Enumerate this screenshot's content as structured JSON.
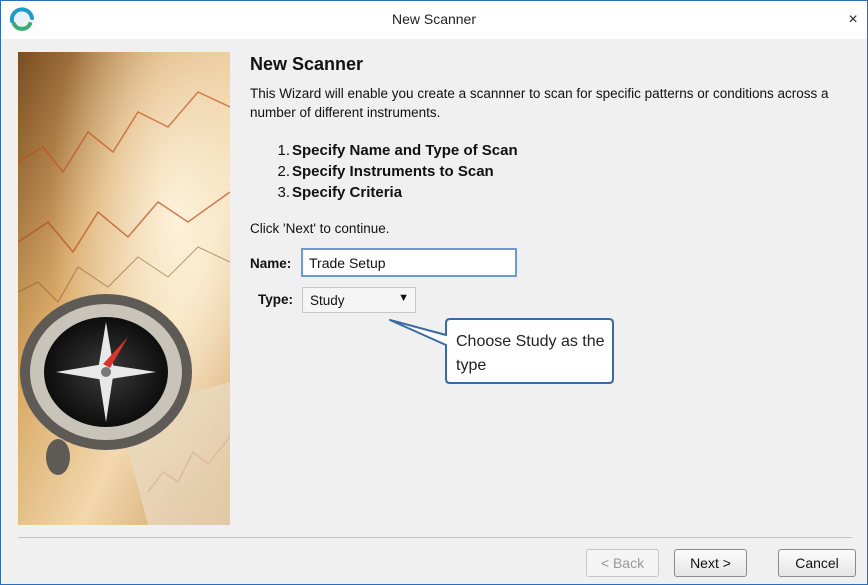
{
  "window": {
    "title": "New Scanner",
    "close_glyph": "×",
    "logo_icon": "app-logo-icon"
  },
  "content": {
    "heading": "New Scanner",
    "description": "This Wizard will enable you create a scannner to scan for specific patterns or conditions across a number of different instruments.",
    "steps": [
      {
        "num": "1.",
        "label": "Specify Name and Type of Scan"
      },
      {
        "num": "2.",
        "label": "Specify Instruments to Scan"
      },
      {
        "num": "3.",
        "label": "Specify Criteria"
      }
    ],
    "hint": "Click 'Next' to continue."
  },
  "form": {
    "name_label": "Name:",
    "name_value": "Trade Setup",
    "type_label": "Type:",
    "type_value": "Study",
    "type_arrow": "▼"
  },
  "callout": {
    "text": "Choose Study as the type"
  },
  "buttons": {
    "back": "< Back",
    "next": "Next >",
    "cancel": "Cancel"
  },
  "colors": {
    "window_border": "#2a6ebd",
    "input_focus_border": "#6d9ad3",
    "callout_border": "#3b6aa0"
  }
}
